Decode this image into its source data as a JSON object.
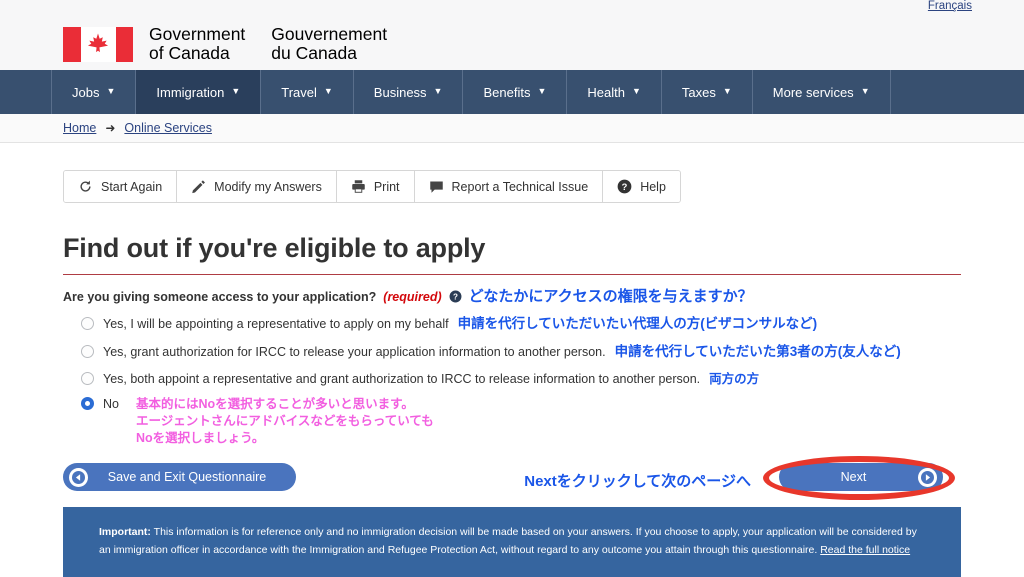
{
  "header": {
    "lang_link": "Français",
    "wordmark_en": "Government\nof Canada",
    "wordmark_fr": "Gouvernement\ndu Canada",
    "flag_icon": "canada-flag-icon"
  },
  "nav": {
    "items": [
      {
        "label": "Jobs",
        "active": false
      },
      {
        "label": "Immigration",
        "active": true
      },
      {
        "label": "Travel",
        "active": false
      },
      {
        "label": "Business",
        "active": false
      },
      {
        "label": "Benefits",
        "active": false
      },
      {
        "label": "Health",
        "active": false
      },
      {
        "label": "Taxes",
        "active": false
      },
      {
        "label": "More services",
        "active": false
      }
    ],
    "caret_icon": "chevron-down-icon"
  },
  "breadcrumb": {
    "home": "Home",
    "arrow": "➜",
    "current": "Online Services"
  },
  "toolbar": {
    "start_again": "Start Again",
    "modify": "Modify my Answers",
    "print": "Print",
    "report": "Report a Technical Issue",
    "help": "Help",
    "icons": {
      "start_again": "refresh-icon",
      "modify": "pencil-icon",
      "print": "printer-icon",
      "report": "comment-icon",
      "help": "question-circle-icon"
    }
  },
  "main": {
    "title": "Find out if you're eligible to apply",
    "question": "Are you giving someone access to your application?",
    "required": "(required)",
    "help_icon": "question-circle-icon",
    "question_note_jp": "どなたかにアクセスの権限を与えますか？",
    "options": [
      {
        "label": "Yes, I will be appointing a representative to apply on my behalf",
        "note_jp": "申請を代行していただいたい代理人の方(ビザコンサルなど)",
        "selected": false
      },
      {
        "label": "Yes, grant authorization for IRCC to release your application information to another person.",
        "note_jp": "申請を代行していただいた第3者の方(友人など)",
        "selected": false
      },
      {
        "label": "Yes, both appoint a representative and grant authorization to IRCC to release information to another person.",
        "note_jp": "両方の方",
        "selected": false
      },
      {
        "label": "No",
        "note_jp": "",
        "selected": true
      }
    ],
    "no_note_jp": "基本的にはNoを選択することが多いと思います。\nエージェントさんにアドバイスなどをもらっていても\nNoを選択しましょう。"
  },
  "actions": {
    "save_label": "Save and Exit Questionnaire",
    "next_label": "Next",
    "next_note_jp": "Nextをクリックして次のページへ",
    "back_icon": "arrow-left-circle-icon",
    "forward_icon": "arrow-right-circle-icon",
    "highlight_icon": "red-oval-annotation"
  },
  "notice": {
    "important_label": "Important:",
    "body_1": " This information is for reference only and no immigration decision will be made based on your answers. If you choose to apply, your application will be considered by an immigration officer in accordance with the Immigration and Refugee Protection Act, without regard to any outcome you attain through this questionnaire. ",
    "link": "Read the full notice"
  },
  "colors": {
    "nav_bg": "#38506f",
    "nav_active": "#2a3f5c",
    "flag_red": "#ea2d37",
    "rule_red": "#af3c43",
    "required_red": "#d3080c",
    "link_blue": "#2b4380",
    "pill_blue": "#4a74be",
    "radio_blue": "#2b6cd4",
    "notice_blue": "#36659f",
    "annotation_blue": "#1a56e8",
    "annotation_pink": "#f25fe0",
    "annotation_oval": "#e8372b"
  }
}
